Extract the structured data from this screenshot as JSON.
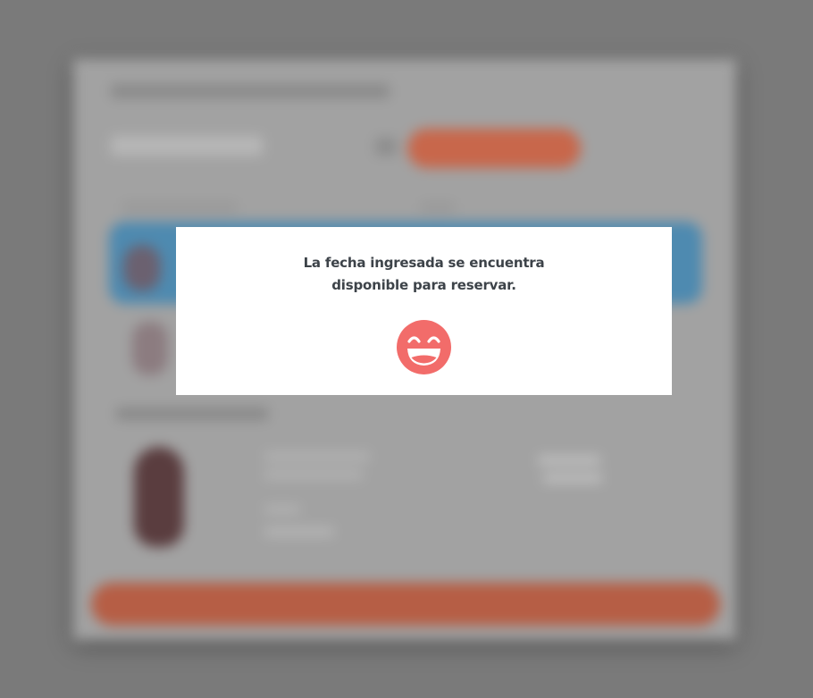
{
  "modal": {
    "message_line1": "La fecha ingresada se encuentra",
    "message_line2": "disponible para reservar.",
    "icon": "grinning-face-icon",
    "icon_color": "#f26c6a"
  },
  "colors": {
    "overlay": "#7a7a7a",
    "modal_background": "#ffffff",
    "text": "#3d4349",
    "accent_orange": "#c8674b",
    "accent_blue": "#4e8ab0"
  }
}
